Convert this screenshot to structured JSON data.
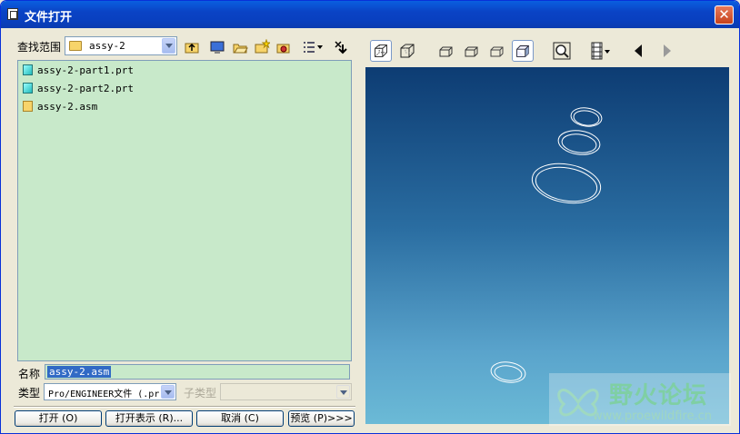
{
  "window": {
    "title": "文件打开",
    "close_glyph": "✕"
  },
  "lookin": {
    "label": "查找范围",
    "value": "assy-2"
  },
  "files": [
    {
      "name": "assy-2-part1.prt",
      "type": "prt"
    },
    {
      "name": "assy-2-part2.prt",
      "type": "prt"
    },
    {
      "name": "assy-2.asm",
      "type": "asm"
    }
  ],
  "name_field": {
    "label": "名称",
    "value": "assy-2.asm"
  },
  "type_field": {
    "label": "类型",
    "value": "Pro/ENGINEER文件 (.pr"
  },
  "subtype_field": {
    "label": "子类型",
    "value": ""
  },
  "buttons": {
    "open": "打开 (O)",
    "open_rep": "打开表示 (R)...",
    "cancel": "取消 (C)",
    "preview": "预览 (P)>>>"
  },
  "watermark": {
    "title": "野火论坛",
    "url": "www.proewildfire.cn"
  },
  "colors": {
    "list_bg": "#c8e9ca",
    "titlebar": "#0a43c5",
    "preview_top": "#0d3c73",
    "preview_bottom": "#6bbad6"
  }
}
